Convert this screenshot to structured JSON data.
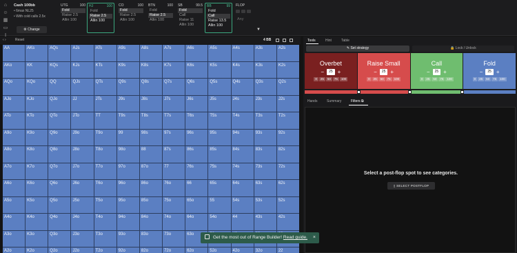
{
  "sidebar_icons": [
    "home-icon",
    "people-icon",
    "grid-icon",
    "chat-icon",
    "text-cursor-icon"
  ],
  "game_info": {
    "title": "Cash 100bb",
    "lines": [
      "• 6max NL25",
      "• With cold calls 2.5x"
    ],
    "change_label": "Change"
  },
  "positions": [
    {
      "name": "UTG",
      "stack": "100",
      "actions": [
        "Fold",
        "Raise 2.5",
        "Allin 100"
      ],
      "selected": 0
    },
    {
      "name": "HJ",
      "stack": "100",
      "actions": [
        "Fold",
        "Raise 2.5",
        "Allin 100"
      ],
      "selected": 1
    },
    {
      "name": "CO",
      "stack": "100",
      "actions": [
        "Fold",
        "Raise 2.5",
        "Allin 100"
      ],
      "selected": 0
    },
    {
      "name": "BTN",
      "stack": "100",
      "actions": [
        "Fold",
        "Raise 2.5",
        "Allin 100"
      ],
      "selected": 1
    },
    {
      "name": "SB",
      "stack": "99.5",
      "actions": [
        "Fold",
        "Call",
        "Raise 11",
        "Allin 100"
      ],
      "selected": 0
    },
    {
      "name": "BB",
      "stack": "99",
      "actions": [
        "Fold",
        "Call",
        "Raise 13.5",
        "Allin 100"
      ],
      "selected": 1
    }
  ],
  "flop": {
    "name": "FLOP",
    "placeholder": "Any"
  },
  "range_header": {
    "nav": "‹ ›",
    "reset": "Reset",
    "combos": "4 BB"
  },
  "hands": [
    [
      "AA",
      "AKs",
      "AQs",
      "AJs",
      "ATs",
      "A9s",
      "A8s",
      "A7s",
      "A6s",
      "A5s",
      "A4s",
      "A3s",
      "A2s"
    ],
    [
      "AKo",
      "KK",
      "KQs",
      "KJs",
      "KTs",
      "K9s",
      "K8s",
      "K7s",
      "K6s",
      "K5s",
      "K4s",
      "K3s",
      "K2s"
    ],
    [
      "AQo",
      "KQo",
      "QQ",
      "QJs",
      "QTs",
      "Q9s",
      "Q8s",
      "Q7s",
      "Q6s",
      "Q5s",
      "Q4s",
      "Q3s",
      "Q2s"
    ],
    [
      "AJo",
      "KJo",
      "QJo",
      "JJ",
      "JTs",
      "J9s",
      "J8s",
      "J7s",
      "J6s",
      "J5s",
      "J4s",
      "J3s",
      "J2s"
    ],
    [
      "ATo",
      "KTo",
      "QTo",
      "JTo",
      "TT",
      "T9s",
      "T8s",
      "T7s",
      "T6s",
      "T5s",
      "T4s",
      "T3s",
      "T2s"
    ],
    [
      "A9o",
      "K9o",
      "Q9o",
      "J9o",
      "T9o",
      "99",
      "98s",
      "97s",
      "96s",
      "95s",
      "94s",
      "93s",
      "92s"
    ],
    [
      "A8o",
      "K8o",
      "Q8o",
      "J8o",
      "T8o",
      "98o",
      "88",
      "87s",
      "86s",
      "85s",
      "84s",
      "83s",
      "82s"
    ],
    [
      "A7o",
      "K7o",
      "Q7o",
      "J7o",
      "T7o",
      "97o",
      "87o",
      "77",
      "76s",
      "75s",
      "74s",
      "73s",
      "72s"
    ],
    [
      "A6o",
      "K6o",
      "Q6o",
      "J6o",
      "T6o",
      "96o",
      "86o",
      "76o",
      "66",
      "65s",
      "64s",
      "63s",
      "62s"
    ],
    [
      "A5o",
      "K5o",
      "Q5o",
      "J5o",
      "T5o",
      "95o",
      "85o",
      "75o",
      "65o",
      "55",
      "54s",
      "53s",
      "52s"
    ],
    [
      "A4o",
      "K4o",
      "Q4o",
      "J4o",
      "T4o",
      "94o",
      "84o",
      "74o",
      "64o",
      "54o",
      "44",
      "43s",
      "42s"
    ],
    [
      "A3o",
      "K3o",
      "Q3o",
      "J3o",
      "T3o",
      "93o",
      "83o",
      "73o",
      "63o",
      "53o",
      "43o",
      "33",
      "32s"
    ],
    [
      "A2o",
      "K2o",
      "Q2o",
      "J2o",
      "T2o",
      "92o",
      "82o",
      "72o",
      "62o",
      "52o",
      "42o",
      "32o",
      "22"
    ]
  ],
  "right_tabs": [
    "Tools",
    "Hint",
    "Table"
  ],
  "tool_buttons": {
    "strategy": "✎ Set strategy",
    "lock": "🔒 Lock / Unlock"
  },
  "strategies": [
    {
      "name": "Overbet",
      "pct": "25",
      "color": "#7a2020",
      "presets": [
        "0",
        "25",
        "50",
        "75",
        "100"
      ]
    },
    {
      "name": "Raise Small",
      "pct": "25",
      "color": "#d64c4c",
      "presets": [
        "0",
        "25",
        "50",
        "75",
        "100"
      ]
    },
    {
      "name": "Call",
      "pct": "25",
      "color": "#6fbd6f",
      "presets": [
        "0",
        "25",
        "50",
        "75",
        "100"
      ]
    },
    {
      "name": "Fold",
      "pct": "25",
      "color": "#5b7fc2",
      "presets": [
        "0",
        "25",
        "50",
        "75",
        "100"
      ]
    }
  ],
  "sub_tabs": [
    "Hands",
    "Summary",
    "Filters"
  ],
  "filters": {
    "empty_message": "Select a post-flop spot to see categories.",
    "select_label": "SELECT POSTFLOP"
  },
  "toast": {
    "text": "Get the most out of Range Builder!",
    "link": "Read guide.",
    "close": "×"
  }
}
